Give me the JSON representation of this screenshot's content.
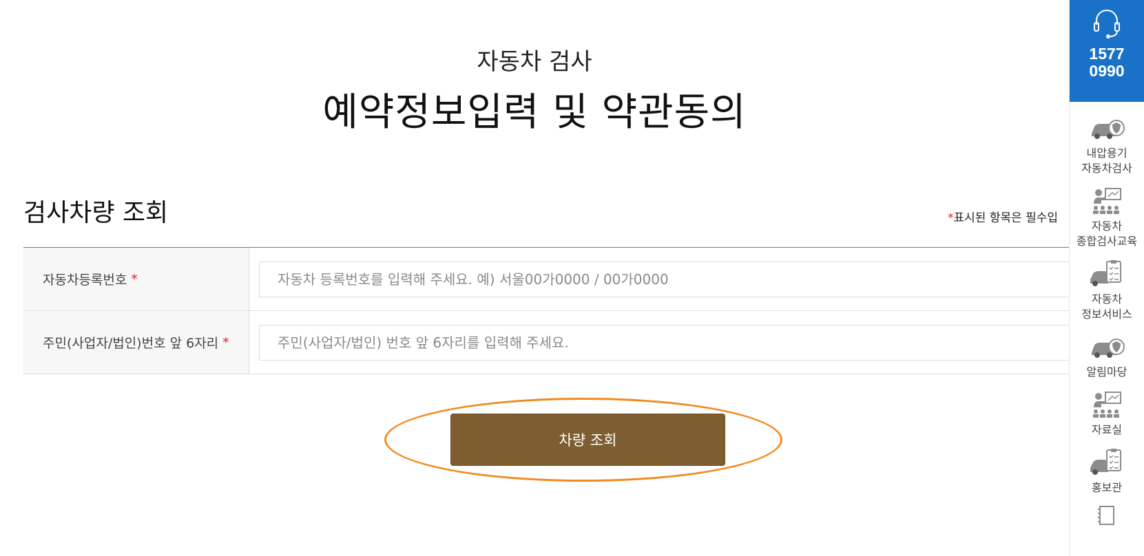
{
  "header": {
    "subtitle": "자동차 검사",
    "title": "예약정보입력 및 약관동의"
  },
  "section": {
    "title": "검사차량 조회",
    "required_note_star": "*",
    "required_note_text": "표시된 항목은 필수입"
  },
  "form": {
    "rows": [
      {
        "label": "자동차등록번호",
        "star": "*",
        "placeholder": "자동차 등록번호를 입력해 주세요. 예) 서울00가0000 / 00가0000",
        "value": ""
      },
      {
        "label": "주민(사업자/법인)번호 앞 6자리",
        "star": "*",
        "placeholder": "주민(사업자/법인) 번호 앞 6자리를 입력해 주세요.",
        "value": ""
      }
    ],
    "submit_label": "차량 조회"
  },
  "side_rail": {
    "phone_icon": "headset-icon",
    "phone_line1": "1577",
    "phone_line2": "0990",
    "items": [
      {
        "icon": "car-shield-icon",
        "label_line1": "내압용기",
        "label_line2": "자동차검사"
      },
      {
        "icon": "instructor-icon",
        "label_line1": "자동차",
        "label_line2": "종합검사교육"
      },
      {
        "icon": "car-checklist-icon",
        "label_line1": "자동차",
        "label_line2": "정보서비스"
      },
      {
        "icon": "car-shield-icon",
        "label_line1": "알림마당",
        "label_line2": ""
      },
      {
        "icon": "instructor-icon",
        "label_line1": "자료실",
        "label_line2": ""
      },
      {
        "icon": "car-checklist-icon",
        "label_line1": "홍보관",
        "label_line2": ""
      },
      {
        "icon": "notebook-icon",
        "label_line1": "",
        "label_line2": ""
      }
    ]
  },
  "colors": {
    "button": "#7e5e31",
    "highlight": "#f28a1c",
    "call_box": "#1a72c8",
    "required": "#d9232e"
  }
}
